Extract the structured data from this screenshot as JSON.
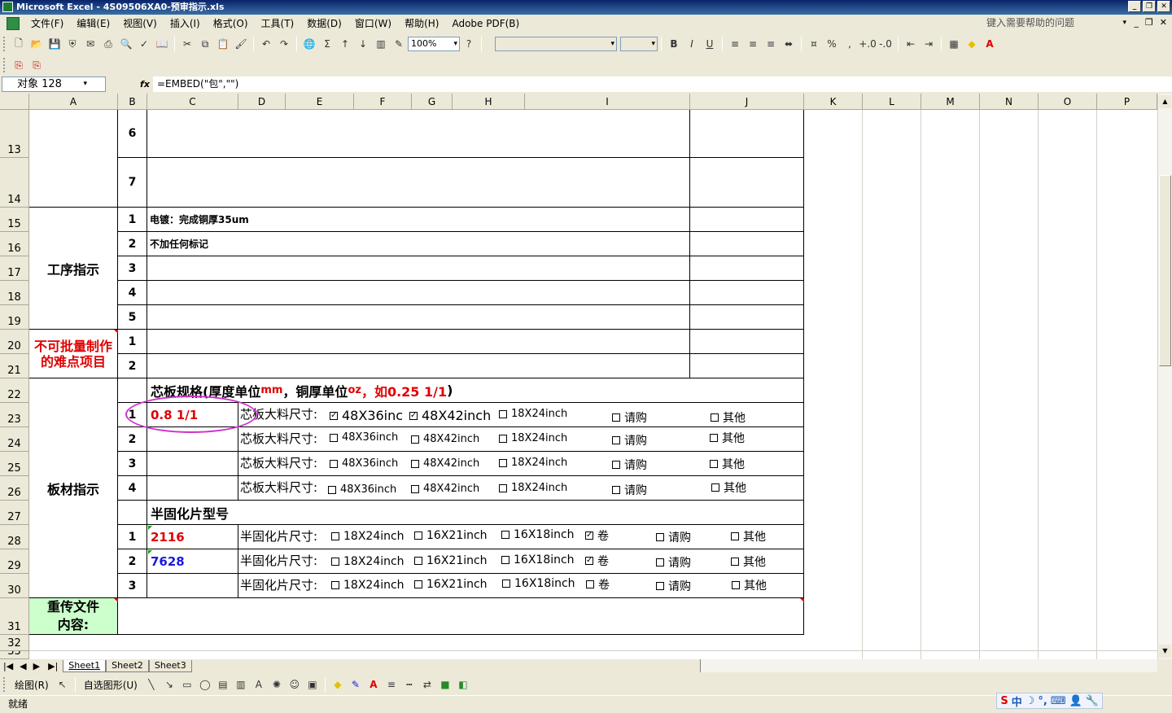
{
  "window": {
    "title": "Microsoft Excel - 4S09506XA0-预审指示.xls"
  },
  "menu": {
    "items": [
      "文件(F)",
      "编辑(E)",
      "视图(V)",
      "插入(I)",
      "格式(O)",
      "工具(T)",
      "数据(D)",
      "窗口(W)",
      "帮助(H)",
      "Adobe PDF(B)"
    ],
    "help_placeholder": "键入需要帮助的问题"
  },
  "toolbar": {
    "zoom": "100%"
  },
  "formula_bar": {
    "name_box": "对象 128",
    "fx": "fx",
    "formula": "=EMBED(\"包\",\"\")"
  },
  "columns": [
    "A",
    "B",
    "C",
    "D",
    "E",
    "F",
    "G",
    "H",
    "I",
    "J",
    "K",
    "L",
    "M",
    "N",
    "O",
    "P"
  ],
  "rows": [
    "13",
    "14",
    "15",
    "16",
    "17",
    "18",
    "19",
    "20",
    "21",
    "22",
    "23",
    "24",
    "25",
    "26",
    "27",
    "28",
    "29",
    "30",
    "31",
    "32",
    "33"
  ],
  "sheet": {
    "r13_num": "6",
    "r14_num": "7",
    "process_label": "工序指示",
    "process": [
      {
        "n": "1",
        "text": "电镀：完成铜厚35um"
      },
      {
        "n": "2",
        "text": "不加任何标记"
      },
      {
        "n": "3",
        "text": ""
      },
      {
        "n": "4",
        "text": ""
      },
      {
        "n": "5",
        "text": ""
      }
    ],
    "difficult_label": "不可批量制作的难点项目",
    "difficult": [
      {
        "n": "1"
      },
      {
        "n": "2"
      }
    ],
    "board_label": "板材指示",
    "core_header": {
      "p1": "芯板规格(厚度单位",
      "p2": "mm",
      "p3": "，铜厚单位",
      "p4": "oz",
      "p5": "，如0.25 1/1",
      "p6": ")"
    },
    "core_rows": [
      {
        "n": "1",
        "value": "0.8 1/1",
        "label": "芯板大料尺寸:",
        "o1": "48X36inc",
        "o2": "48X42inch",
        "o3": "18X24inch",
        "o4": "请购",
        "o5": "其他",
        "c1": "✓",
        "c2": "✓",
        "c3": "",
        "c4": "",
        "c5": ""
      },
      {
        "n": "2",
        "value": "",
        "label": "芯板大料尺寸:",
        "o1": "48X36inch",
        "o2": "48X42inch",
        "o3": "18X24inch",
        "o4": "请购",
        "o5": "其他",
        "c1": "",
        "c2": "",
        "c3": "",
        "c4": "",
        "c5": ""
      },
      {
        "n": "3",
        "value": "",
        "label": "芯板大料尺寸:",
        "o1": "48X36inch",
        "o2": "48X42inch",
        "o3": "18X24inch",
        "o4": "请购",
        "o5": "其他",
        "c1": "",
        "c2": "",
        "c3": "",
        "c4": "",
        "c5": ""
      },
      {
        "n": "4",
        "value": "",
        "label": "芯板大料尺寸:",
        "o1": "48X36inch",
        "o2": "48X42inch",
        "o3": "18X24inch",
        "o4": "请购",
        "o5": "其他",
        "c1": "",
        "c2": "",
        "c3": "",
        "c4": "",
        "c5": ""
      }
    ],
    "prepreg_header": "半固化片型号",
    "prepreg_rows": [
      {
        "n": "1",
        "value": "2116",
        "label": "半固化片尺寸:",
        "o1": "18X24inch",
        "o2": "16X21inch",
        "o3": "16X18inch",
        "o4": "卷",
        "o5": "请购",
        "o6": "其他",
        "c4": "✓"
      },
      {
        "n": "2",
        "value": "7628",
        "label": "半固化片尺寸:",
        "o1": "18X24inch",
        "o2": "16X21inch",
        "o3": "16X18inch",
        "o4": "卷",
        "o5": "请购",
        "o6": "其他",
        "c4": "✓"
      },
      {
        "n": "3",
        "value": "",
        "label": "半固化片尺寸:",
        "o1": "18X24inch",
        "o2": "16X21inch",
        "o3": "16X18inch",
        "o4": "卷",
        "o5": "请购",
        "o6": "其他",
        "c4": ""
      }
    ],
    "reupload_label": "重传文件内容:"
  },
  "tabs": [
    "Sheet1",
    "Sheet2",
    "Sheet3"
  ],
  "drawbar": {
    "draw": "绘图(R)",
    "autoshape": "自选图形(U)"
  },
  "status": {
    "text": "就绪"
  },
  "ime": {
    "lang": "中"
  },
  "colors": {
    "red": "#e00000",
    "blue": "#1a1ae0",
    "green_cell": "#ccffcc",
    "ellipse": "#cc33cc"
  }
}
